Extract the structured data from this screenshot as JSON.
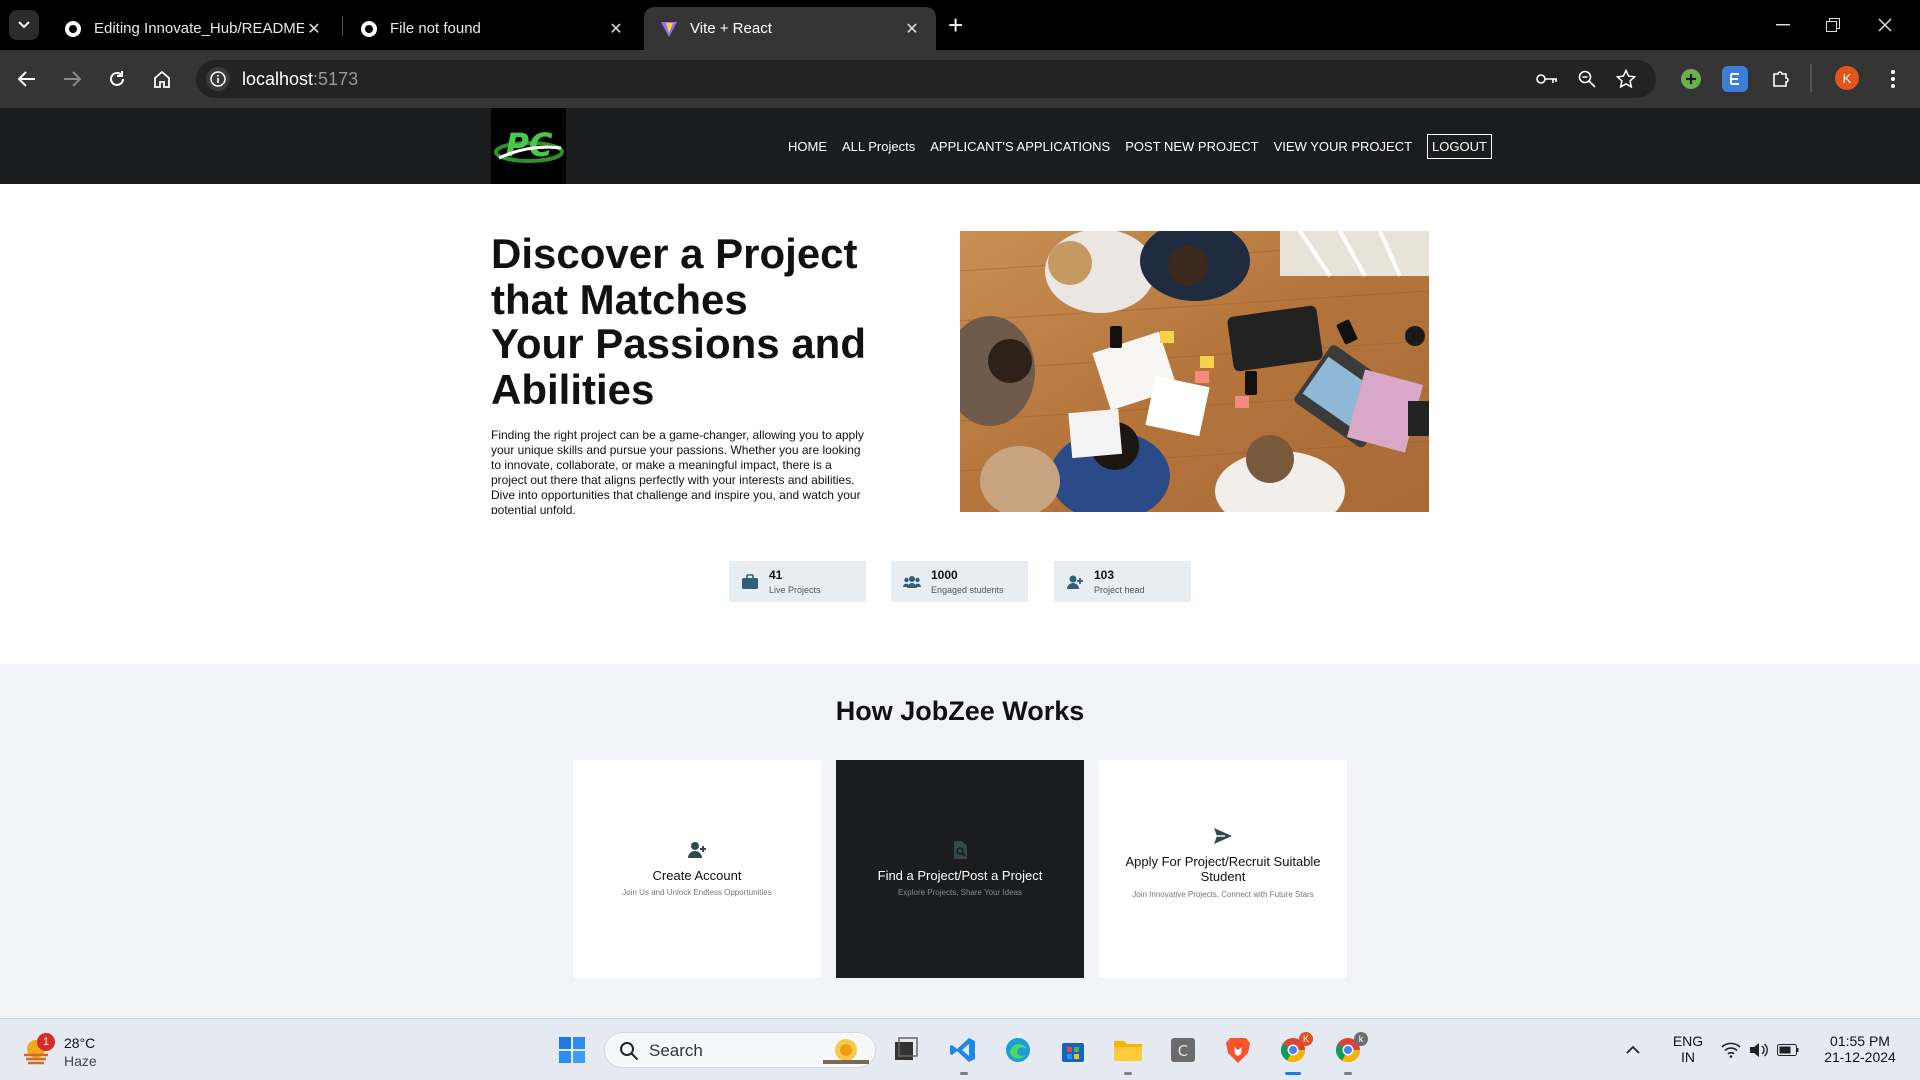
{
  "browser": {
    "tabs": [
      {
        "title": "Editing Innovate_Hub/README",
        "active": false
      },
      {
        "title": "File not found",
        "active": false
      },
      {
        "title": "Vite + React",
        "active": true
      }
    ],
    "url_host": "localhost",
    "url_port": ":5173"
  },
  "navbar": {
    "logo_text": "PC",
    "links": [
      "HOME",
      "ALL Projects",
      "APPLICANT'S APPLICATIONS",
      "POST NEW PROJECT",
      "VIEW YOUR PROJECT"
    ],
    "logout": "LOGOUT"
  },
  "hero": {
    "title_line1": "Discover a Project that Matches",
    "title_line2": "Your Passions and Abilities",
    "description": "Finding the right project can be a game-changer, allowing you to apply your unique skills and pursue your passions. Whether you are looking to innovate, collaborate, or make a meaningful impact, there is a project out there that aligns perfectly with your interests and abilities. Dive into opportunities that challenge and inspire you, and watch your potential unfold."
  },
  "stats": [
    {
      "value": "41",
      "label": "Live Projects",
      "icon": "briefcase-icon"
    },
    {
      "value": "1000",
      "label": "Engaged students",
      "icon": "users-icon"
    },
    {
      "value": "103",
      "label": "Project head",
      "icon": "user-plus-icon"
    }
  ],
  "how": {
    "title": "How JobZee Works",
    "cards": [
      {
        "title": "Create Account",
        "subtitle": "Join Us and Unlock Endless Opportunities",
        "icon": "user-plus-icon"
      },
      {
        "title": "Find a Project/Post a Project",
        "subtitle": "Explore Projects, Share Your Ideas",
        "icon": "file-search-icon"
      },
      {
        "title": "Apply For Project/Recruit Suitable Student",
        "subtitle": "Join Innovative Projects, Connect with Future Stars",
        "icon": "send-icon"
      }
    ]
  },
  "taskbar": {
    "weather_temp": "28°C",
    "weather_cond": "Haze",
    "weather_badge": "1",
    "search_label": "Search",
    "lang_1": "ENG",
    "lang_2": "IN",
    "time": "01:55 PM",
    "date": "21-12-2024"
  },
  "colors": {
    "navbar": "#1b1c1e",
    "how_bg": "#f1f3f7",
    "stat_bg": "#e8edf2",
    "accent_icon": "#2f5f7a"
  }
}
